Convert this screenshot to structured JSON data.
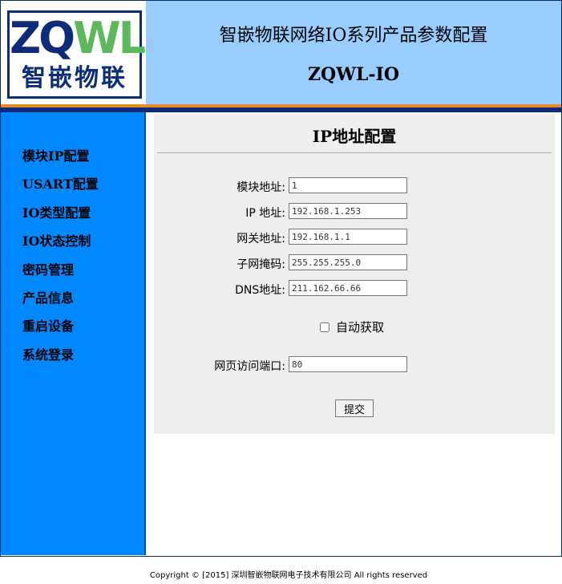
{
  "header": {
    "logo_text": "ZQWL",
    "logo_cn": "智嵌物联",
    "title": "智嵌物联网络IO系列产品参数配置",
    "subtitle": "ZQWL-IO"
  },
  "sidebar": {
    "items": [
      {
        "label": "模块IP配置"
      },
      {
        "label": "USART配置"
      },
      {
        "label": "IO类型配置"
      },
      {
        "label": "IO状态控制"
      },
      {
        "label": "密码管理"
      },
      {
        "label": "产品信息"
      },
      {
        "label": "重启设备"
      },
      {
        "label": "系统登录"
      }
    ]
  },
  "main": {
    "title": "IP地址配置",
    "fields": [
      {
        "label": "模块地址:",
        "value": "1"
      },
      {
        "label": "IP 地址:",
        "value": "192.168.1.253"
      },
      {
        "label": "网关地址:",
        "value": "192.168.1.1"
      },
      {
        "label": "子网掩码:",
        "value": "255.255.255.0"
      },
      {
        "label": "DNS地址:",
        "value": "211.162.66.66"
      }
    ],
    "auto_label": "自动获取",
    "auto_checked": false,
    "port_label": "网页访问端口:",
    "port_value": "80",
    "submit_label": "提交"
  },
  "footer": {
    "text": "Copyright © [2015] 深圳智嵌物联网电子技术有限公司 All rights reserved"
  },
  "colors": {
    "header_bg": "#99ccff",
    "sidebar_bg": "#0088ff",
    "accent_orange": "#e88a2a",
    "accent_navy": "#0d2d7a",
    "content_bg": "#eeeeee"
  }
}
